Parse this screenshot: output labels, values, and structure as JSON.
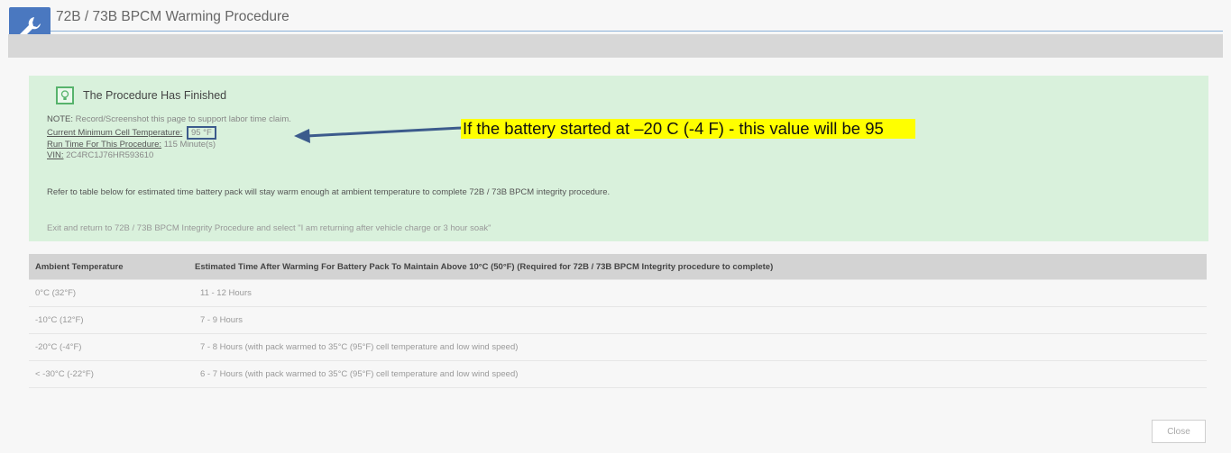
{
  "header": {
    "title": "72B / 73B BPCM Warming Procedure",
    "icon": "wrench-icon"
  },
  "panel": {
    "title": "The Procedure Has Finished",
    "note_label": "NOTE:",
    "note_text": "Record/Screenshot this page to support labor time claim.",
    "min_temp_label": "Current Minimum Cell Temperature:",
    "min_temp_value": "95 °F",
    "runtime_label": "Run Time For This Procedure:",
    "runtime_value": "115 Minute(s)",
    "vin_label": "VIN:",
    "vin_value": "2C4RC1J76HR593610",
    "refer_text": "Refer to table below for estimated time battery pack will stay warm enough at ambient temperature to complete 72B / 73B BPCM integrity procedure.",
    "exit_text": "Exit and return to 72B / 73B BPCM Integrity Procedure and select \"I am returning after vehicle charge or 3 hour soak\""
  },
  "callout": {
    "text": "If the battery started at –20 C (-4 F) - this value will be 95",
    "color": "#ffff00"
  },
  "table": {
    "headers": [
      "Ambient Temperature",
      "Estimated Time After Warming For Battery Pack To Maintain Above 10°C (50°F) (Required for 72B / 73B BPCM Integrity procedure to complete)"
    ],
    "rows": [
      {
        "temp": "0°C (32°F)",
        "time": "11 - 12 Hours"
      },
      {
        "temp": "-10°C (12°F)",
        "time": "7 - 9 Hours"
      },
      {
        "temp": "-20°C (-4°F)",
        "time": "7 - 8 Hours (with pack warmed to 35°C (95°F) cell temperature and low wind speed)"
      },
      {
        "temp": "< -30°C (-22°F)",
        "time": "6 - 7 Hours (with pack warmed to 35°C (95°F) cell temperature and low wind speed)"
      }
    ]
  },
  "buttons": {
    "close": "Close"
  },
  "colors": {
    "accent": "#4a78c0",
    "panel_bg": "#d9f1dc",
    "callout_bg": "#ffff00",
    "arrow": "#3c5b8c"
  }
}
